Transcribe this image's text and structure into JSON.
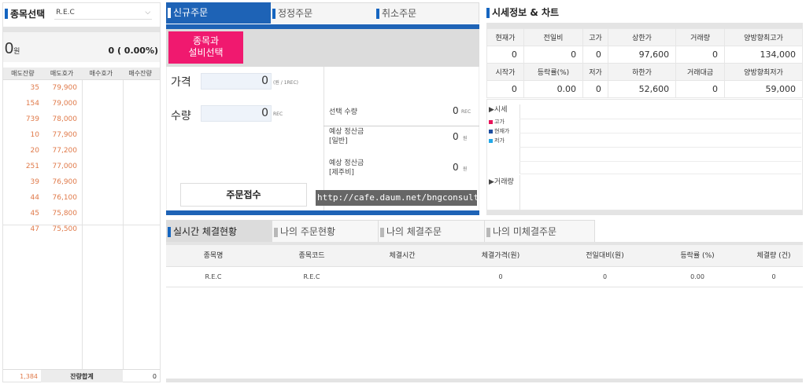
{
  "left": {
    "title": "종목선택",
    "selected_item": "R.E.C",
    "price": "0",
    "price_unit": "원",
    "change": "0 ( 0.00%)",
    "headers": [
      "매도잔량",
      "매도호가",
      "매수호가",
      "매수잔량"
    ],
    "rows": [
      {
        "qty": "35",
        "price": "79,900"
      },
      {
        "qty": "154",
        "price": "79,000"
      },
      {
        "qty": "739",
        "price": "78,000"
      },
      {
        "qty": "10",
        "price": "77,900"
      },
      {
        "qty": "20",
        "price": "77,200"
      },
      {
        "qty": "251",
        "price": "77,000"
      },
      {
        "qty": "39",
        "price": "76,900"
      },
      {
        "qty": "44",
        "price": "76,100"
      },
      {
        "qty": "45",
        "price": "75,800"
      },
      {
        "qty": "47",
        "price": "75,500"
      }
    ],
    "footer": {
      "sell_total": "1,384",
      "label": "잔량합계",
      "buy_total": "0"
    }
  },
  "order": {
    "tabs": [
      "신규주문",
      "정정주문",
      "취소주문"
    ],
    "select_button": "종목과 설비선택",
    "price_label": "가격",
    "price_value": "0",
    "price_unit": "(원 / 1REC)",
    "qty_label": "수량",
    "qty_value": "0",
    "qty_unit": "REC",
    "sel_qty_label": "선택 수량",
    "sel_qty_value": "0",
    "sel_qty_unit": "REC",
    "est1_label_1": "예상 정산금",
    "est1_label_2": "[일반]",
    "est1_value": "0",
    "est1_unit": "원",
    "est2_label_1": "예상 정산금",
    "est2_label_2": "[제주비]",
    "est2_value": "0",
    "est2_unit": "원",
    "submit": "주문접수",
    "watermark": "http://cafe.daum.net/bngconsulting"
  },
  "market": {
    "title": "시세정보 & 차트",
    "row1_headers": [
      "현재가",
      "전일비",
      "고가",
      "상한가",
      "거래량",
      "양방향최고가"
    ],
    "row1_values": [
      "0",
      "0",
      "0",
      "97,600",
      "0",
      "134,000"
    ],
    "row2_headers": [
      "시작가",
      "등락률(%)",
      "저가",
      "하한가",
      "거래대금",
      "양방향최저가"
    ],
    "row2_values": [
      "0",
      "0.00",
      "0",
      "52,600",
      "0",
      "59,000"
    ],
    "chart_label": "▶시세",
    "legend": [
      {
        "name": "고가",
        "color": "#e8145a"
      },
      {
        "name": "현재가",
        "color": "#1e4fa0"
      },
      {
        "name": "저가",
        "color": "#22a8e8"
      }
    ],
    "volume_label": "▶거래량"
  },
  "bottom": {
    "tabs": [
      "실시간 체결현황",
      "나의 주문현황",
      "나의 체결주문",
      "나의 미체결주문"
    ],
    "headers": [
      "종목명",
      "종목코드",
      "체결시간",
      "체결가격(원)",
      "전일대비(원)",
      "등락률 (%)",
      "체결량 (건)"
    ],
    "row": [
      "R.E.C",
      "R.E.C",
      "",
      "0",
      "0",
      "0.00",
      "0"
    ]
  },
  "colors": {
    "accent": "#1e63b6",
    "pink": "#f0196f",
    "sell": "#e07a4a"
  }
}
